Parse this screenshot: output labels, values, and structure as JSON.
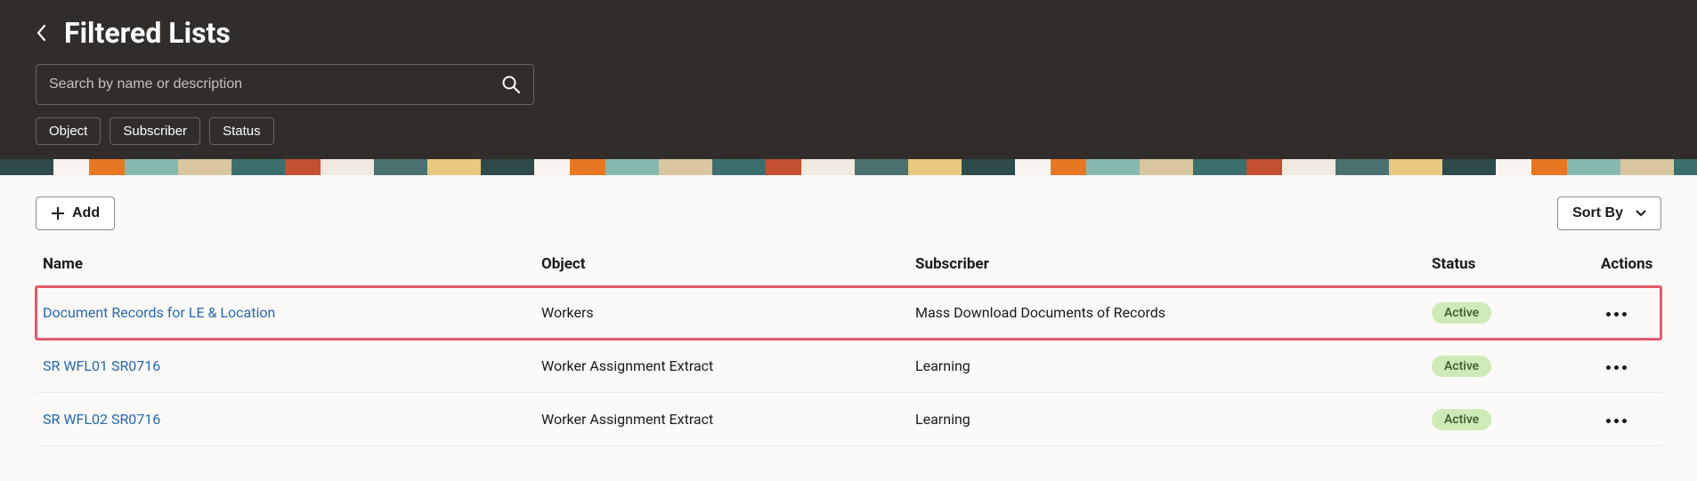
{
  "header": {
    "title": "Filtered Lists",
    "search_placeholder": "Search by name or description",
    "filter_chips": [
      "Object",
      "Subscriber",
      "Status"
    ]
  },
  "toolbar": {
    "add_label": "Add",
    "sort_label": "Sort By"
  },
  "table": {
    "columns": {
      "name": "Name",
      "object": "Object",
      "subscriber": "Subscriber",
      "status": "Status",
      "actions": "Actions"
    },
    "rows": [
      {
        "name": "Document Records for LE & Location",
        "object": "Workers",
        "subscriber": "Mass Download Documents of Records",
        "status": "Active",
        "highlight": true
      },
      {
        "name": "SR WFL01 SR0716",
        "object": "Worker Assignment Extract",
        "subscriber": "Learning",
        "status": "Active",
        "highlight": false
      },
      {
        "name": "SR WFL02 SR0716",
        "object": "Worker Assignment Extract",
        "subscriber": "Learning",
        "status": "Active",
        "highlight": false
      }
    ]
  }
}
